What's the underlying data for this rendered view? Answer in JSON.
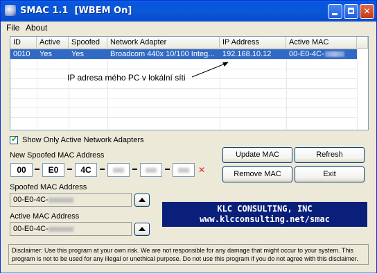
{
  "window": {
    "title": "SMAC 1.1  [WBEM On]",
    "app_icon": "smac-app-icon",
    "controls": [
      "minimize",
      "maximize",
      "close"
    ]
  },
  "menu": {
    "items": [
      "File",
      "About"
    ]
  },
  "adapters_table": {
    "columns": [
      "ID",
      "Active",
      "Spoofed",
      "Network Adapter",
      "IP Address",
      "Active MAC"
    ],
    "rows": [
      {
        "id": "0010",
        "active": "Yes",
        "spoofed": "Yes",
        "adapter": "Broadcom 440x 10/100 Integ...",
        "ip": "192.168.10.12",
        "mac": "00-E0-4C-",
        "selected": true
      }
    ]
  },
  "annotation": {
    "text": "IP adresa mého PC v lokální síti"
  },
  "show_only_active": {
    "label": "Show Only Active Network Adapters",
    "checked": true
  },
  "new_mac": {
    "label": "New Spoofed MAC Address",
    "octets": [
      "00",
      "E0",
      "4C",
      "",
      "",
      ""
    ],
    "clear_icon": "clear-x-icon"
  },
  "spoofed_mac": {
    "label": "Spoofed MAC Address",
    "value": "00-E0-4C-"
  },
  "active_mac": {
    "label": "Active MAC Address",
    "value": "00-E0-4C-"
  },
  "buttons": {
    "update": "Update MAC",
    "refresh": "Refresh",
    "remove": "Remove MAC",
    "exit": "Exit"
  },
  "banner": {
    "line1": "KLC CONSULTING, INC",
    "line2": "www.klcconsulting.net/smac"
  },
  "disclaimer": "Disclaimer: Use this program at your own risk.  We are not responsible for any damage that might occur to your system.  This program is not to be used for any illegal or unethical purpose.  Do not use this program if you do not agree with this disclaimer.",
  "colors": {
    "title_bar": "#0a58d6",
    "selection": "#316ac5",
    "banner_bg": "#0a1f7a",
    "face": "#ece9d8"
  }
}
